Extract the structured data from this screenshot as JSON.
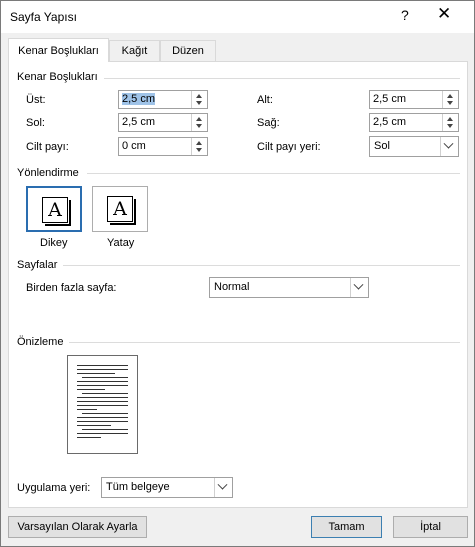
{
  "window": {
    "title": "Sayfa Yapısı",
    "help_label": "?",
    "close_label": "✕"
  },
  "tabs": [
    {
      "label": "Kenar Boşlukları",
      "active": true
    },
    {
      "label": "Kağıt",
      "active": false
    },
    {
      "label": "Düzen",
      "active": false
    }
  ],
  "margins": {
    "title": "Kenar Boşlukları",
    "top_label": "Üst:",
    "top_value": "2,5 cm",
    "bottom_label": "Alt:",
    "bottom_value": "2,5 cm",
    "left_label": "Sol:",
    "left_value": "2,5 cm",
    "right_label": "Sağ:",
    "right_value": "2,5 cm",
    "gutter_label": "Cilt payı:",
    "gutter_value": "0 cm",
    "gutter_pos_label": "Cilt payı yeri:",
    "gutter_pos_value": "Sol"
  },
  "orientation": {
    "title": "Yönlendirme",
    "portrait_label": "Dikey",
    "landscape_label": "Yatay",
    "icon_letter": "A",
    "selected": "portrait"
  },
  "pages": {
    "title": "Sayfalar",
    "multiple_label": "Birden fazla sayfa:",
    "multiple_value": "Normal"
  },
  "preview": {
    "title": "Önizleme"
  },
  "apply": {
    "label": "Uygulama yeri:",
    "value": "Tüm belgeye"
  },
  "buttons": {
    "default_label": "Varsayılan Olarak Ayarla",
    "ok_label": "Tamam",
    "cancel_label": "İptal"
  },
  "colors": {
    "selection_border": "#2a6db0",
    "text_selection": "#9fc3e8",
    "default_button_border": "#3c7fb1"
  }
}
